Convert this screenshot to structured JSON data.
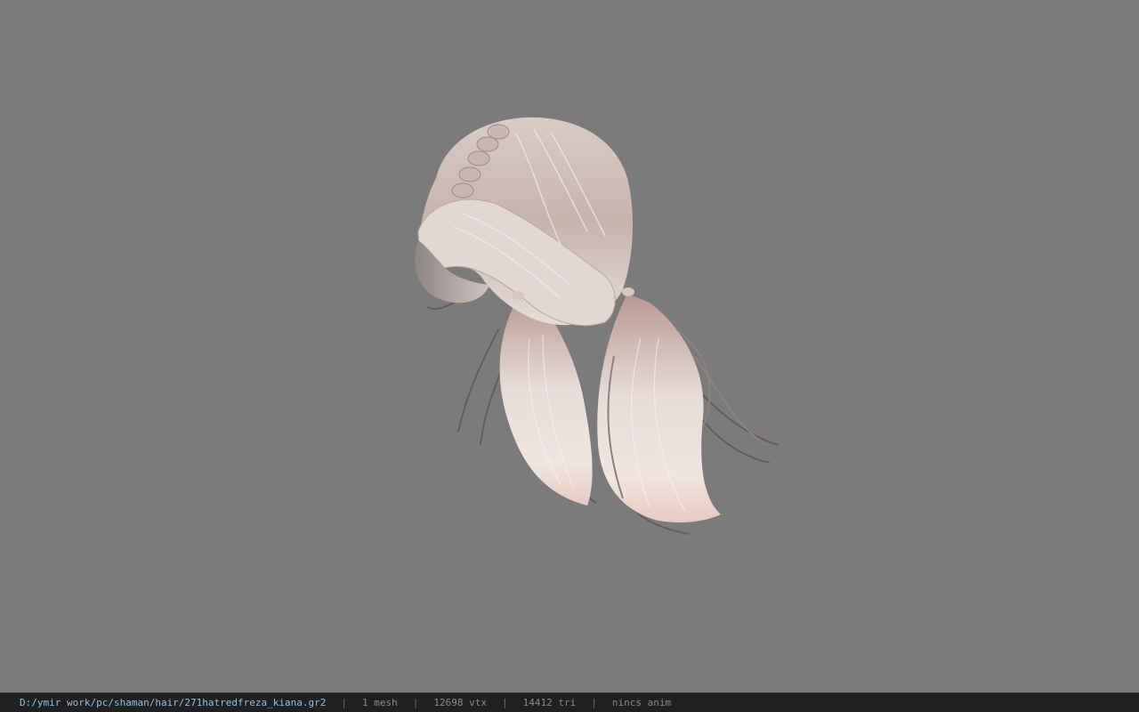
{
  "viewer": {
    "background_color": "#7b7b7b",
    "model_name": "271hatredfreza_kiana.gr2"
  },
  "status_bar": {
    "file_path": "D:/ymir work/pc/shaman/hair/271hatredfreza_kiana.gr2",
    "separator": "|",
    "mesh_count": "1 mesh",
    "vertex_count": "12698 vtx",
    "triangle_count": "14412 tri",
    "animation": "nincs anim",
    "text_color": "#8a8a8a",
    "path_color": "#8fc0e0",
    "background_color": "#202020"
  }
}
